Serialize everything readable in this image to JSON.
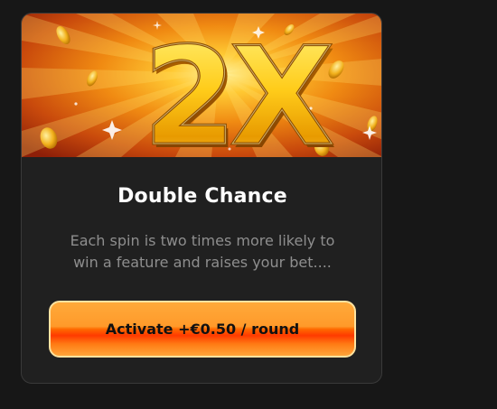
{
  "banner": {
    "image_text": "2x",
    "colors": {
      "ray_center": "#ffd84a",
      "ray_edge": "#b8340a",
      "gold": "#ffcc1a"
    }
  },
  "card": {
    "title": "Double Chance",
    "description_line1": "Each spin is two times more likely to",
    "description_line2": "win a feature and raises your bet....",
    "activate_label": "Activate +€0.50 / round"
  },
  "colors": {
    "page_background": "#171717",
    "card_background": "#202020",
    "button_orange": "#ff8a1e",
    "button_border": "#ffe3a0"
  }
}
